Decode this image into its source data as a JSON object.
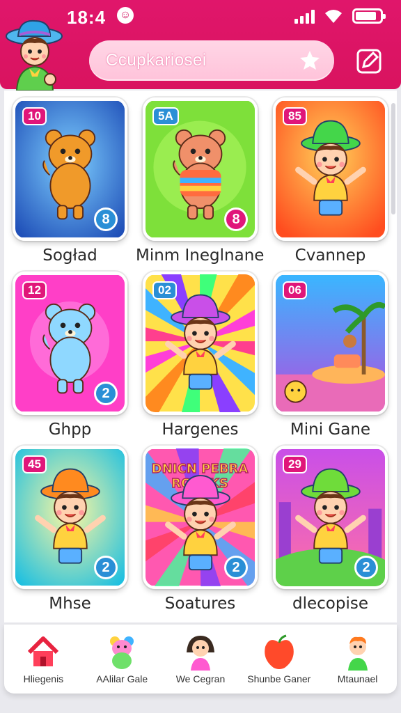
{
  "status": {
    "time": "18:4",
    "battery_level": 0.85
  },
  "search": {
    "text": "Ccupkariosei"
  },
  "colors": {
    "header": "#dd1565",
    "search_pill": "#ffc8dc",
    "badge_pink": "#e0167a",
    "badge_blue": "#2a8fd6"
  },
  "games": [
    {
      "title": "Sogład",
      "num": "10",
      "circle": "8",
      "bg": "blue-sparkle",
      "icon": "bear-icon"
    },
    {
      "title": "Minm Ineglnanes",
      "num": "5A",
      "circle": "8",
      "bg": "green",
      "icon": "hamster-icon"
    },
    {
      "title": "Cvannep",
      "num": "85",
      "circle": "",
      "bg": "orange",
      "icon": "boy-green-hat-icon"
    },
    {
      "title": "Ghpp",
      "num": "12",
      "circle": "2",
      "bg": "magenta",
      "icon": "rainbow-bear-icon"
    },
    {
      "title": "Hargenes",
      "num": "02",
      "circle": "",
      "bg": "rainbow-burst",
      "icon": "boy-purple-hat-icon"
    },
    {
      "title": "Mini Gane",
      "num": "06",
      "circle": "",
      "bg": "island",
      "icon": "palm-tree-icon"
    },
    {
      "title": "Mhse",
      "num": "45",
      "circle": "2",
      "bg": "cyan-burst",
      "icon": "boy-orange-hat-icon"
    },
    {
      "title": "Soatures",
      "num": "",
      "circle": "2",
      "bg": "title-card",
      "banner": "DNICN PEBRA ROPEKS",
      "icon": "boy-pink-hat-icon"
    },
    {
      "title": "dlecopise",
      "num": "29",
      "circle": "2",
      "bg": "purple-city",
      "icon": "boy-green-cap-icon"
    }
  ],
  "nav": [
    {
      "label": "Hliegenis",
      "icon": "home-icon"
    },
    {
      "label": "AAlilar Gale",
      "icon": "rainbow-bear-icon"
    },
    {
      "label": "We Cegran",
      "icon": "girl-icon"
    },
    {
      "label": "Shunbe Ganer",
      "icon": "apple-icon"
    },
    {
      "label": "Mtaunael",
      "icon": "boy-icon"
    }
  ]
}
